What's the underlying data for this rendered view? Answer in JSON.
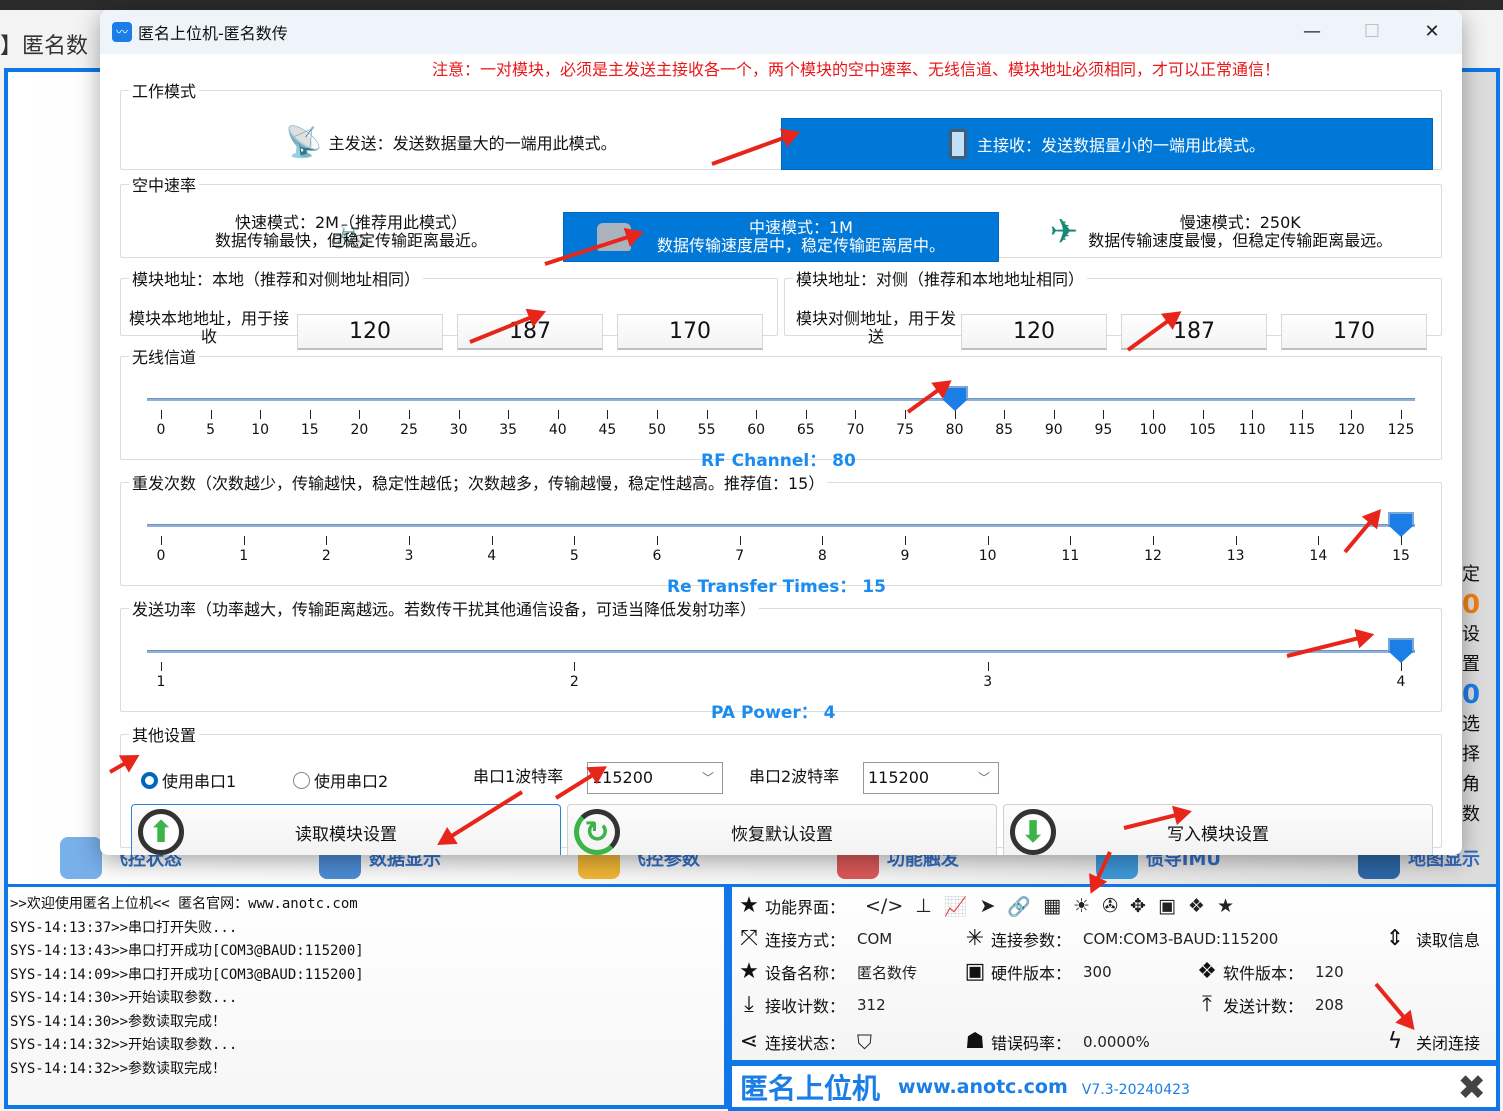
{
  "background_app": {
    "title_fragment": "】匿名数",
    "bottom_tabs": [
      "飞控状态",
      "数据显示",
      "飞控参数",
      "功能触发",
      "惯导IMU",
      "地图显示"
    ],
    "right_fragments": [
      "定",
      "0",
      "设置",
      "0",
      "选择",
      "角",
      "数"
    ]
  },
  "dialog": {
    "title": "匿名上位机-匿名数传",
    "window_buttons": {
      "minimize": "—",
      "maximize": "☐",
      "close": "✕"
    },
    "warning": "注意：一对模块，必须是主发送主接收各一个，两个模块的空中速率、无线信道、模块地址必须相同，才可以正常通信！",
    "work_mode": {
      "legend": "工作模式",
      "options": [
        {
          "icon": "antenna-icon",
          "label": "主发送：发送数据量大的一端用此模式。",
          "selected": false
        },
        {
          "icon": "phone-vibrate-icon",
          "label": "主接收：发送数据量小的一端用此模式。",
          "selected": true
        }
      ]
    },
    "air_rate": {
      "legend": "空中速率",
      "options": [
        {
          "icon": "bicycle-icon",
          "line1": "快速模式：2M（推荐用此模式）",
          "line2": "数据传输最快，但稳定传输距离最近。",
          "selected": false
        },
        {
          "icon": "car-icon",
          "line1": "中速模式：1M",
          "line2": "数据传输速度居中，稳定传输距离居中。",
          "selected": true
        },
        {
          "icon": "airplane-icon",
          "line1": "慢速模式：250K",
          "line2": "数据传输速度最慢，但稳定传输距离最远。",
          "selected": false
        }
      ]
    },
    "local_address": {
      "legend": "模块地址：本地（推荐和对侧地址相同）",
      "label": "模块本地地址，用于接收",
      "values": [
        "120",
        "187",
        "170"
      ]
    },
    "remote_address": {
      "legend": "模块地址：对侧（推荐和本地地址相同）",
      "label": "模块对侧地址，用于发送",
      "values": [
        "120",
        "187",
        "170"
      ]
    },
    "channel": {
      "legend": "无线信道",
      "min": 0,
      "max": 125,
      "step_label": 5,
      "value": 80,
      "readout_label": "RF Channel：",
      "readout_value": "80"
    },
    "retransfer": {
      "legend": "重发次数（次数越少，传输越快，稳定性越低；次数越多，传输越慢，稳定性越高。推荐值：15）",
      "min": 0,
      "max": 15,
      "step_label": 1,
      "value": 15,
      "readout_label": "Re Transfer Times：",
      "readout_value": "15"
    },
    "pa_power": {
      "legend": "发送功率（功率越大，传输距离越远。若数传干扰其他通信设备，可适当降低发射功率）",
      "min": 1,
      "max": 4,
      "step_label": 1,
      "value": 4,
      "readout_label": "PA Power：",
      "readout_value": "4"
    },
    "other": {
      "legend": "其他设置",
      "radio1": {
        "label": "使用串口1",
        "checked": true
      },
      "radio2": {
        "label": "使用串口2",
        "checked": false
      },
      "baud1_label": "串口1波特率",
      "baud1_value": "115200",
      "baud2_label": "串口2波特率",
      "baud2_value": "115200"
    },
    "buttons": {
      "read": "读取模块设置",
      "reset": "恢复默认设置",
      "write": "写入模块设置"
    }
  },
  "console": {
    "lines": [
      ">>欢迎使用匿名上位机<<  匿名官网：www.anotc.com",
      "SYS-14:13:37>>串口打开失败...",
      "SYS-14:13:43>>串口打开成功[COM3@BAUD:115200]",
      "SYS-14:14:09>>串口打开成功[COM3@BAUD:115200]",
      "SYS-14:14:30>>开始读取参数...",
      "SYS-14:14:30>>参数读取完成！",
      "SYS-14:14:32>>开始读取参数...",
      "SYS-14:14:32>>参数读取完成！"
    ]
  },
  "info_panel": {
    "function_label": "功能界面：",
    "function_icons": [
      "code-icon",
      "hierarchy-icon",
      "chart-icon",
      "send-icon",
      "link-icon",
      "grid-icon",
      "sun-icon",
      "aperture-icon",
      "move-icon",
      "chip-icon",
      "logo-icon",
      "star-icon"
    ],
    "connect_mode_label": "连接方式：",
    "connect_mode_value": "COM",
    "connect_param_label": "连接参数：",
    "connect_param_value": "COM:COM3-BAUD:115200",
    "read_info": "读取信息",
    "device_name_label": "设备名称：",
    "device_name_value": "匿名数传",
    "hw_version_label": "硬件版本：",
    "hw_version_value": "300",
    "sw_version_label": "软件版本：",
    "sw_version_value": "120",
    "rx_count_label": "接收计数：",
    "rx_count_value": "312",
    "tx_count_label": "发送计数：",
    "tx_count_value": "208",
    "conn_status_label": "连接状态：",
    "error_rate_label": "错误码率：",
    "error_rate_value": "0.0000%",
    "close_conn": "关闭连接"
  },
  "brand": {
    "name": "匿名上位机",
    "url": "www.anotc.com",
    "version": "V7.3-20240423"
  }
}
